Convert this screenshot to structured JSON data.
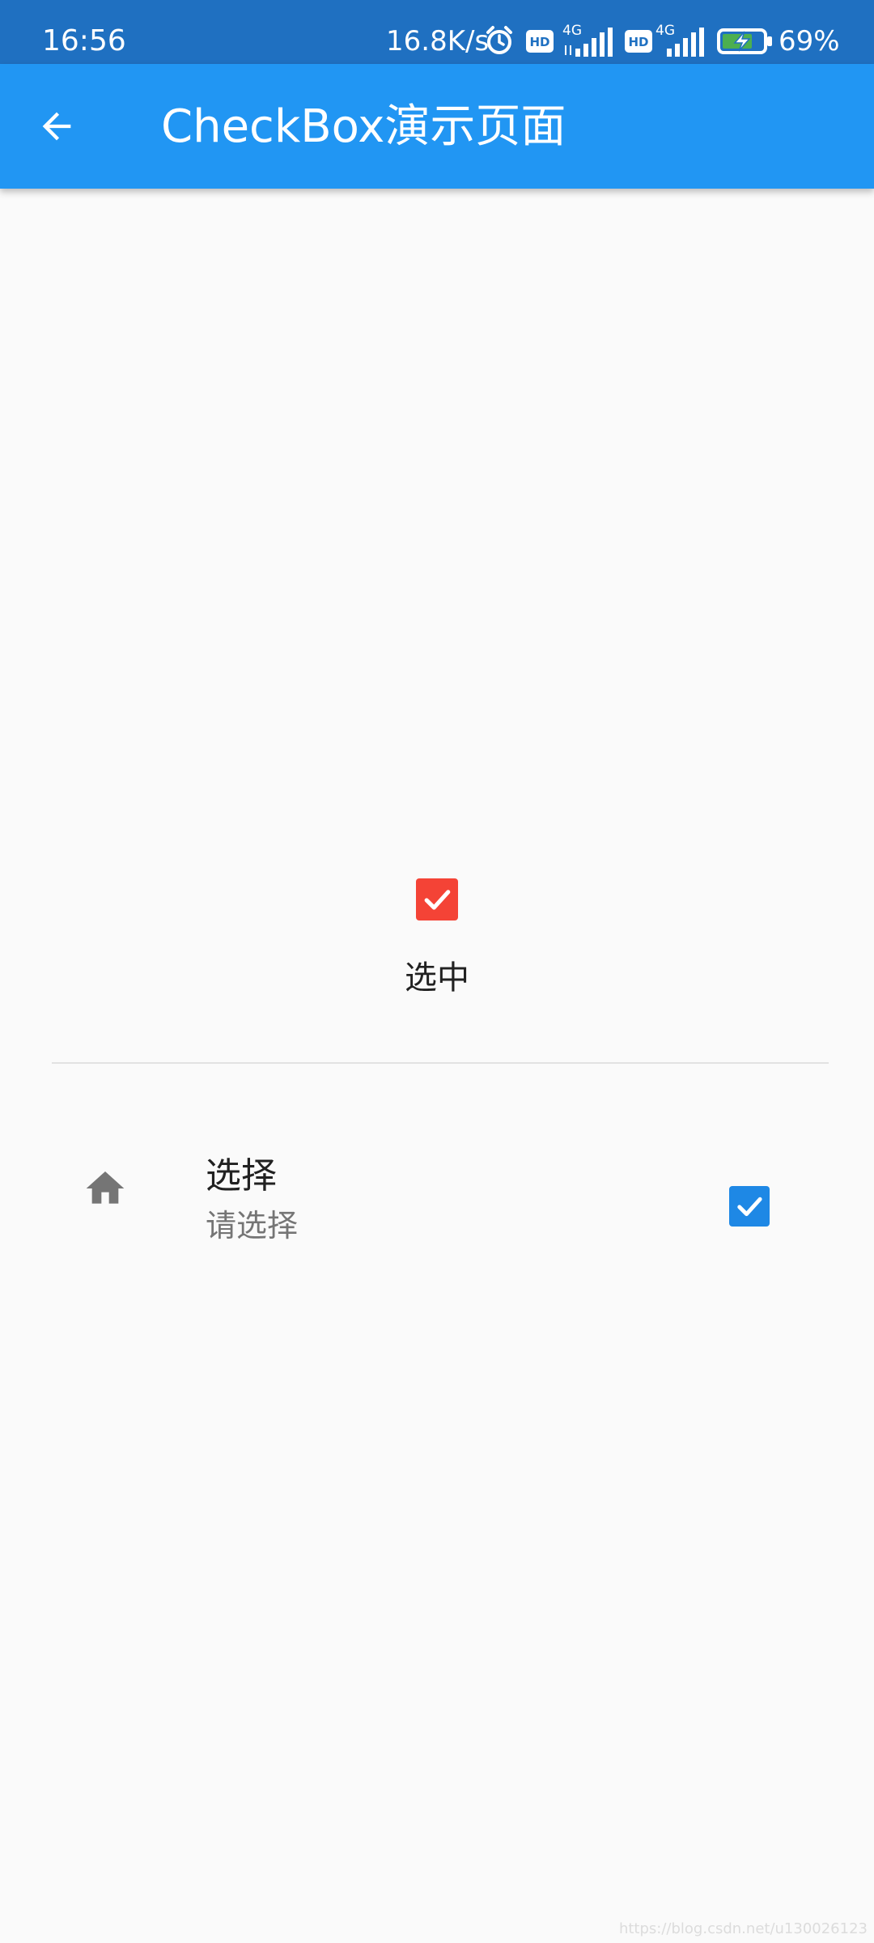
{
  "status_bar": {
    "time": "16:56",
    "net_speed": "16.8K/s",
    "hd_label": "HD",
    "network_1": "4G",
    "network_2": "4G",
    "battery": "69%",
    "background_color": "#1f70c1"
  },
  "app_bar": {
    "title": "CheckBox演示页面",
    "back_icon": "arrow-back-icon",
    "background_color": "#2196f3"
  },
  "center_checkbox": {
    "checked": true,
    "active_color": "#f44336",
    "label": "选中"
  },
  "list_tile": {
    "icon": "home-icon",
    "title": "选择",
    "subtitle": "请选择",
    "checked": true,
    "active_color": "#1e88e5"
  },
  "watermark": "https://blog.csdn.net/u130026123"
}
